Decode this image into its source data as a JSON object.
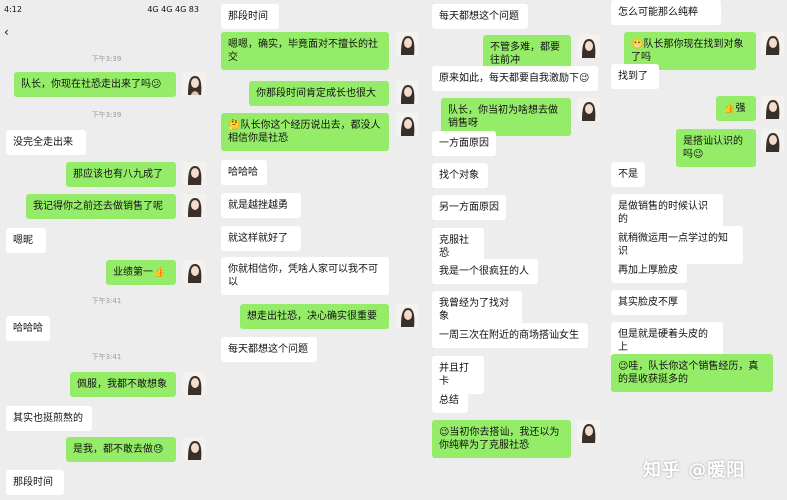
{
  "status_bar": {
    "time": "4:12",
    "right": "4G 4G 4G 83"
  },
  "panel1": {
    "back_icon": "back-icon",
    "times": [
      "下午3:39",
      "下午3:39",
      "下午3:41",
      "下午3:41"
    ],
    "msgs": [
      "队长，你现在社恐走出来了吗😕",
      "没完全走出来",
      "那应该也有八九成了",
      "我记得你之前还去做销售了呢",
      "嗯昵",
      "业绩第一👍",
      "哈哈哈",
      "佩服，我都不敢想象",
      "其实也挺煎熬的",
      "是我，都不敢去做😓",
      "那段时间"
    ]
  },
  "panel2": {
    "msgs": [
      "那段时间",
      "嗯嗯，确实，毕竟面对不擅长的社交",
      "你那段时间肯定成长也很大",
      "🤔队长你这个经历说出去，都没人相信你是社恐",
      "哈哈哈",
      "就是越挫越勇",
      "就这样就好了",
      "你就相信你，凭啥人家可以我不可以",
      "想走出社恐，决心确实很重要",
      "每天都想这个问题"
    ]
  },
  "panel3": {
    "msgs": [
      "每天都想这个问题",
      "不管多难，都要往前冲",
      "原来如此，每天都要自我激励下😉",
      "队长，你当初为啥想去做销售呀",
      "一方面原因",
      "找个对象",
      "另一方面原因",
      "克服社恐",
      "我是一个很疯狂的人",
      "我曾经为了找对象",
      "一周三次在附近的商场搭讪女生",
      "并且打卡",
      "总结",
      "😉当初你去搭讪，我还以为你纯粹为了克服社恐"
    ]
  },
  "panel4": {
    "msgs": [
      "怎么可能那么纯粹",
      "😬队长那你现在找到对象了吗",
      "找到了",
      "👍强",
      "是搭讪认识的吗😉",
      "不是",
      "是做销售的时候认识的",
      "就稍微运用一点学过的知识",
      "再加上厚脸皮",
      "其实脸皮不厚",
      "但是就是硬着头皮的上",
      "😉哇，队长你这个销售经历，真的是收获挺多的"
    ]
  },
  "watermark": "知乎 @暖阳"
}
